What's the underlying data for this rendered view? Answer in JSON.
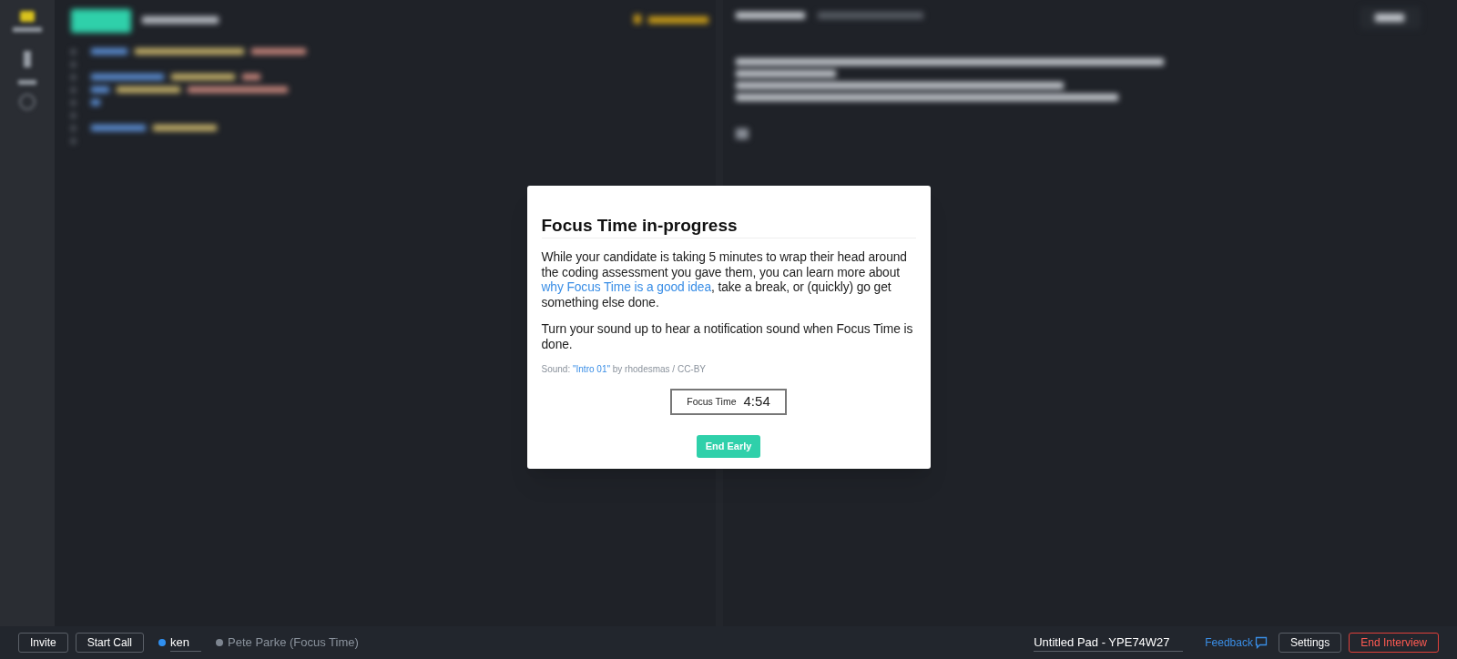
{
  "dialog": {
    "title": "Focus Time in-progress",
    "paragraphs": [
      [
        {
          "text": "While your candidate is taking 5 minutes to wrap their head around the coding assessment you gave them, you can learn more about ",
          "link": false
        },
        {
          "text": "why Focus Time is a good idea",
          "link": true
        },
        {
          "text": ", take a break, or (quickly) go get something else done.",
          "link": false
        }
      ],
      [
        {
          "text": "Turn your sound up to hear a notification sound when Focus Time is done.",
          "link": false
        }
      ]
    ],
    "credit": [
      {
        "text": "Sound: ",
        "link": false
      },
      {
        "text": "\"Intro 01\"",
        "link": true
      },
      {
        "text": " by rhodesmas / CC-BY",
        "link": false
      }
    ],
    "timer": {
      "label": "Focus Time",
      "value": "4:54"
    },
    "button": "End Early"
  },
  "bottom_bar": {
    "left_buttons": [
      "Invite",
      "Start Call"
    ],
    "participants": [
      {
        "name": "ken",
        "color": "#2f8ff0",
        "kind": "field"
      },
      {
        "name": "Pete Parke (Focus Time)",
        "color": "#7d8590",
        "kind": "text"
      }
    ],
    "pad_title": "Untitled Pad - YPE74W27",
    "feedback": "Feedback",
    "right_buttons": [
      {
        "label": "Settings",
        "kind": "normal"
      },
      {
        "label": "End Interview",
        "kind": "danger"
      }
    ]
  }
}
